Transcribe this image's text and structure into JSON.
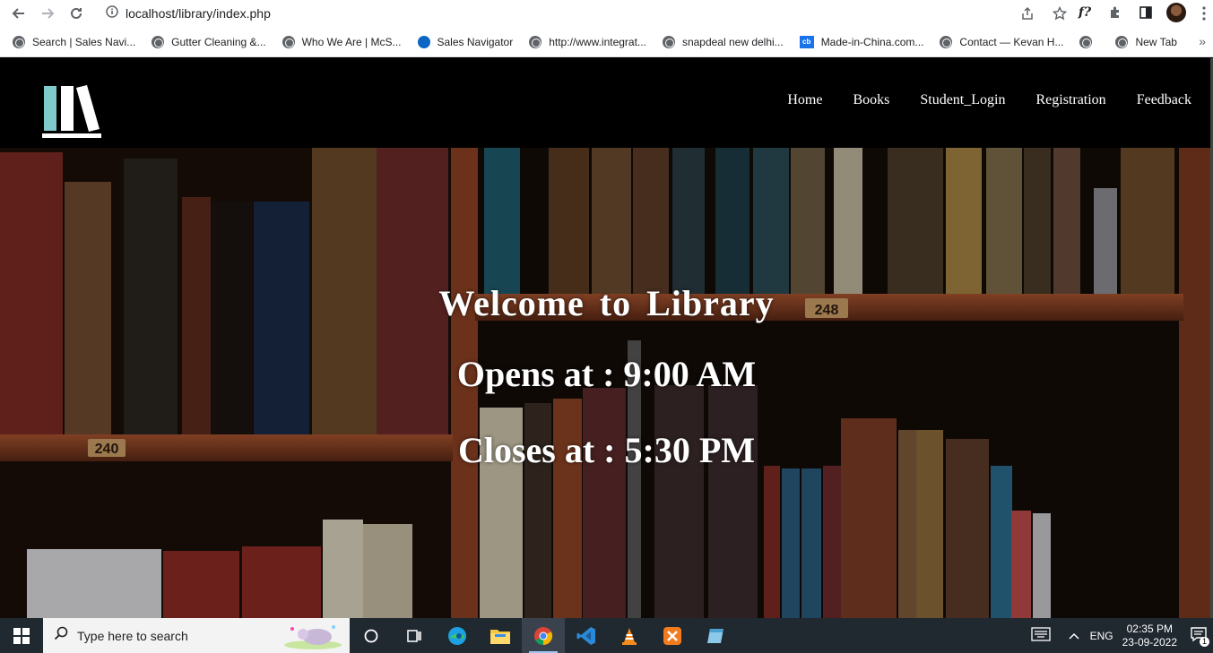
{
  "browser": {
    "url": "localhost/library/index.php",
    "bookmarks": [
      {
        "label": "Search | Sales Navi...",
        "icon": "globe-icon"
      },
      {
        "label": "Gutter Cleaning &...",
        "icon": "globe-icon"
      },
      {
        "label": "Who We Are | McS...",
        "icon": "globe-icon"
      },
      {
        "label": "Sales Navigator",
        "icon": "sales-navigator-icon"
      },
      {
        "label": "http://www.integrat...",
        "icon": "globe-icon"
      },
      {
        "label": "snapdeal new delhi...",
        "icon": "globe-icon"
      },
      {
        "label": "Made-in-China.com...",
        "icon": "cb-icon"
      },
      {
        "label": "Contact — Kevan H...",
        "icon": "globe-icon"
      },
      {
        "label": "",
        "icon": "globe-icon"
      },
      {
        "label": "New Tab",
        "icon": "globe-icon"
      }
    ],
    "extension_label": "f?"
  },
  "site": {
    "nav": [
      "Home",
      "Books",
      "Student_Login",
      "Registration",
      "Feedback"
    ],
    "hero": {
      "title": "Welcome  to  Library",
      "opens": "Opens at : 9:00 AM",
      "closes": "Closes at : 5:30 PM"
    },
    "shelf_labels": [
      "240",
      "248"
    ]
  },
  "taskbar": {
    "search_placeholder": "Type here to search",
    "language": "ENG",
    "time": "02:35 PM",
    "date": "23-09-2022",
    "notification_count": "1"
  },
  "colors": {
    "logo_teal": "#7fcbcb",
    "header_bg": "#000000",
    "taskbar_bg": "#202830"
  }
}
